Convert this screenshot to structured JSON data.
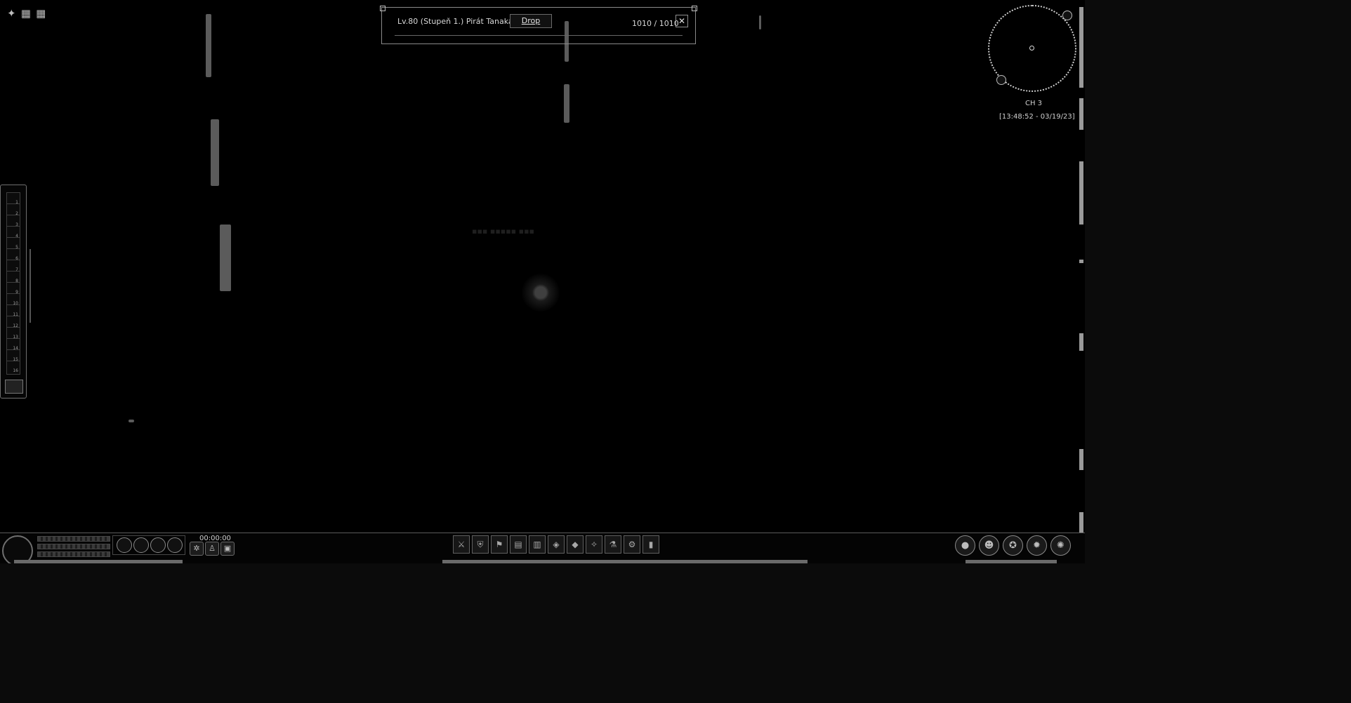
{
  "target": {
    "name": "Lv.80 (Stupeň 1.) Pirát Tanaka",
    "drop_label": "Drop",
    "hp": "1010 / 1010",
    "close_icon": "close-icon"
  },
  "hud": {
    "channel": "CH 3",
    "datetime": "[13:48:52 - 03/19/23]",
    "timer": "00:00:00"
  },
  "quickbar": {
    "slots": [
      "1",
      "2",
      "3",
      "4",
      "5",
      "6",
      "7",
      "8",
      "9",
      "10",
      "11",
      "12",
      "13",
      "14",
      "15",
      "16"
    ]
  },
  "taskbar": {
    "skill_icons": [
      "whirl-skill-icon",
      "statue-skill-icon",
      "box-skill-icon"
    ],
    "slot_icons": [
      "sword-icon",
      "shield-icon",
      "flag-icon",
      "book-icon",
      "scroll-icon",
      "bag-icon",
      "gem-icon",
      "rune-icon",
      "potion-icon",
      "gear-icon",
      "lock-icon"
    ],
    "right_icons": [
      "menu-icon",
      "character-icon",
      "inventory-icon",
      "skills-icon",
      "settings-icon"
    ]
  }
}
